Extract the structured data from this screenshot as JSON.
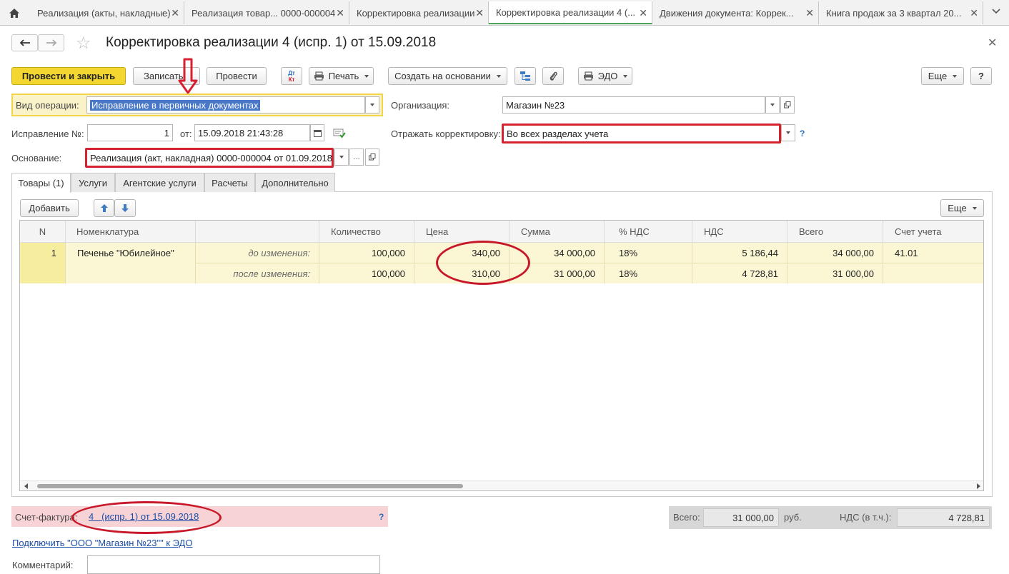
{
  "tabs": [
    {
      "label": "Реализация (акты, накладные)"
    },
    {
      "label": "Реализация товар... 0000-000004"
    },
    {
      "label": "Корректировка реализации"
    },
    {
      "label": "Корректировка реализации 4 (..."
    },
    {
      "label": "Движения документа: Коррек..."
    },
    {
      "label": "Книга продаж за 3 квартал 20..."
    }
  ],
  "header": {
    "title": "Корректировка реализации 4 (испр. 1) от 15.09.2018"
  },
  "toolbar": {
    "post_close": "Провести и закрыть",
    "save": "Записать",
    "post": "Провести",
    "dt_top": "Дт",
    "dt_bottom": "Кт",
    "print": "Печать",
    "create_based": "Создать на основании",
    "edo": "ЭДО",
    "more": "Еще",
    "help": "?"
  },
  "form": {
    "operation_label": "Вид операции:",
    "operation_value": "Исправление в первичных документах",
    "org_label": "Организация:",
    "org_value": "Магазин №23",
    "correction_no_label": "Исправление №:",
    "correction_no_value": "1",
    "date_label": "от:",
    "date_value": "15.09.2018 21:43:28",
    "reflect_label": "Отражать корректировку:",
    "reflect_value": "Во всех разделах учета",
    "basis_label": "Основание:",
    "basis_value": "Реализация (акт, накладная) 0000-000004 от 01.09.2018",
    "dots": "..."
  },
  "form_tabs": [
    "Товары (1)",
    "Услуги",
    "Агентские услуги",
    "Расчеты",
    "Дополнительно"
  ],
  "table_toolbar": {
    "add": "Добавить",
    "more": "Еще"
  },
  "table": {
    "columns": [
      "N",
      "Номенклатура",
      "",
      "Количество",
      "Цена",
      "Сумма",
      "% НДС",
      "НДС",
      "Всего",
      "Счет учета"
    ],
    "row": {
      "n": "1",
      "item": "Печенье \"Юбилейное\"",
      "before_label": "до изменения:",
      "after_label": "после изменения:",
      "before": {
        "qty": "100,000",
        "price": "340,00",
        "sum": "34 000,00",
        "vat_rate": "18%",
        "vat": "5 186,44",
        "total": "34 000,00",
        "account": "41.01"
      },
      "after": {
        "qty": "100,000",
        "price": "310,00",
        "sum": "31 000,00",
        "vat_rate": "18%",
        "vat": "4 728,81",
        "total": "31 000,00"
      }
    }
  },
  "footer": {
    "invoice_label": "Счет-фактура:",
    "invoice_link": "4   (испр. 1) от 15.09.2018",
    "invoice_help": "?",
    "total_label": "Всего:",
    "total_value": "31 000,00",
    "currency": "руб.",
    "vat_label": "НДС (в т.ч.):",
    "vat_value": "4 728,81",
    "edo_link": "Подключить \"ООО \"Магазин №23\"\" к ЭДО",
    "comment_label": "Комментарий:"
  },
  "colors": {
    "primary_button": "#f4d631",
    "annotation_red": "#d42230",
    "row_highlight": "#fbf7d4",
    "invoice_panel": "#f7d3d5"
  }
}
